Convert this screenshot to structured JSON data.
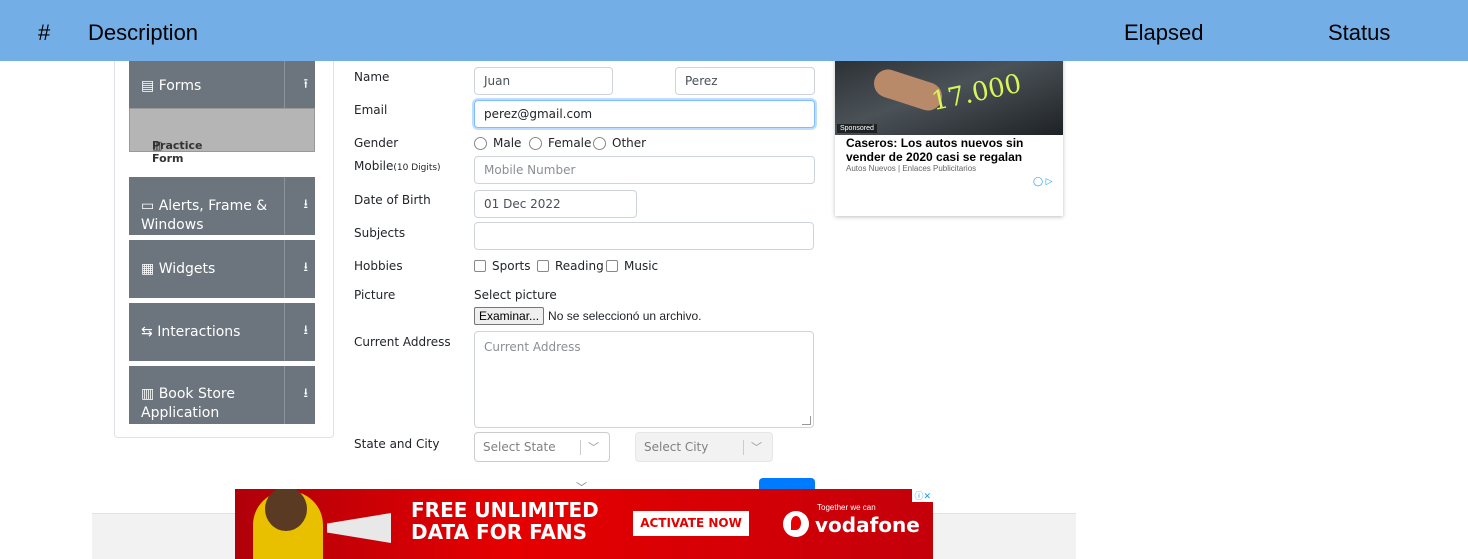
{
  "report_header": {
    "hash": "#",
    "description": "Description",
    "elapsed": "Elapsed",
    "status": "Status"
  },
  "menu": {
    "groups": [
      {
        "label": "Forms",
        "icon": "file-icon",
        "arrow": "arrow-up-icon"
      },
      {
        "label": "Alerts, Frame & Windows",
        "icon": "window-icon",
        "arrow": "arrow-down-icon"
      },
      {
        "label": "Widgets",
        "icon": "grid-icon",
        "arrow": "arrow-down-icon"
      },
      {
        "label": "Interactions",
        "icon": "swap-icon",
        "arrow": "arrow-down-icon"
      },
      {
        "label": "Book Store Application",
        "icon": "books-icon",
        "arrow": "arrow-down-icon"
      }
    ],
    "active_item": "Practice Form"
  },
  "form": {
    "name_label": "Name",
    "first_name": "Juan",
    "last_name": "Perez",
    "email_label": "Email",
    "email": "perez@gmail.com",
    "gender_label": "Gender",
    "genders": [
      "Male",
      "Female",
      "Other"
    ],
    "mobile_label": "Mobile",
    "mobile_hint": "(10 Digits)",
    "mobile_placeholder": "Mobile Number",
    "dob_label": "Date of Birth",
    "dob": "01 Dec 2022",
    "subjects_label": "Subjects",
    "hobbies_label": "Hobbies",
    "hobbies": [
      "Sports",
      "Reading",
      "Music"
    ],
    "picture_label": "Picture",
    "picture_select": "Select picture",
    "file_button": "Examinar...",
    "file_status": "No se seleccionó un archivo.",
    "address_label": "Current Address",
    "address_placeholder": "Current Address",
    "state_city_label": "State and City",
    "state_placeholder": "Select State",
    "city_placeholder": "Select City"
  },
  "ad": {
    "price": "17.000",
    "sponsored": "Sponsored",
    "title": "Caseros: Los autos nuevos sin vender de 2020 casi se regalan",
    "source": "Autos Nuevos | Enlaces Publicitarios",
    "choices": "◯ ▷"
  },
  "banner": {
    "headline_1": "FREE UNLIMITED",
    "headline_2": "DATA FOR FANS",
    "cta": "ACTIVATE NOW",
    "tagline": "Together we can",
    "brand": "vodafone",
    "ad_mark": "ⓘ✕"
  },
  "colors": {
    "header_bg": "#74aee6",
    "menu_bg": "#6c757d",
    "primary": "#007bff",
    "vodafone_red": "#e60000"
  }
}
